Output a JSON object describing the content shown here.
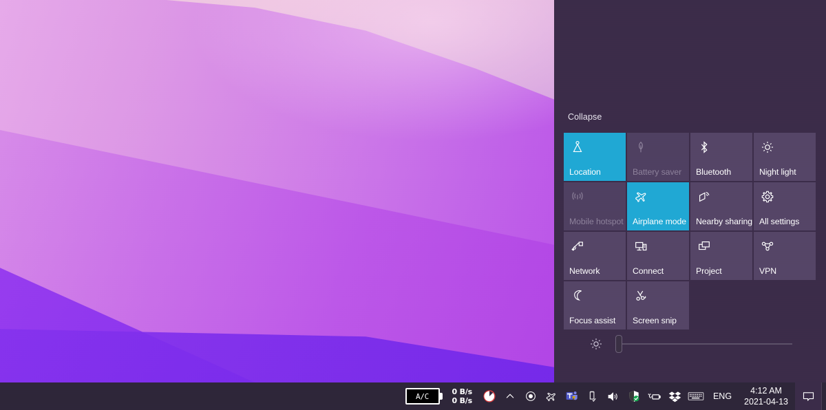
{
  "desktop": {
    "wallpaper_name": "purple-waves-wallpaper",
    "colors": {
      "light_pink": "#f2cfe4",
      "orchid": "#d08ae8",
      "violet": "#8d37ef",
      "deep_violet": "#6f26ea"
    }
  },
  "action_center": {
    "panel_name": "Action Center",
    "background_color": "#3b2c49",
    "accent_color": "#1fa8d4",
    "collapse_label": "Collapse",
    "quick_actions": [
      {
        "label": "Location",
        "icon": "location-icon",
        "state": "on"
      },
      {
        "label": "Battery saver",
        "icon": "leaf-icon",
        "state": "disabled"
      },
      {
        "label": "Bluetooth",
        "icon": "bluetooth-icon",
        "state": "off"
      },
      {
        "label": "Night light",
        "icon": "night-light-icon",
        "state": "off"
      },
      {
        "label": "Mobile hotspot",
        "icon": "hotspot-icon",
        "state": "disabled"
      },
      {
        "label": "Airplane mode",
        "icon": "airplane-icon",
        "state": "on"
      },
      {
        "label": "Nearby sharing",
        "icon": "nearby-sharing-icon",
        "state": "off"
      },
      {
        "label": "All settings",
        "icon": "gear-icon",
        "state": "off"
      },
      {
        "label": "Network",
        "icon": "network-icon",
        "state": "off"
      },
      {
        "label": "Connect",
        "icon": "connect-icon",
        "state": "off"
      },
      {
        "label": "Project",
        "icon": "project-icon",
        "state": "off"
      },
      {
        "label": "VPN",
        "icon": "vpn-icon",
        "state": "off"
      },
      {
        "label": "Focus assist",
        "icon": "moon-icon",
        "state": "off"
      },
      {
        "label": "Screen snip",
        "icon": "screen-snip-icon",
        "state": "off"
      }
    ],
    "brightness": {
      "icon": "brightness-icon",
      "value_percent": 0
    }
  },
  "taskbar": {
    "background_color": "#2e2539",
    "battery_widget": {
      "name": "ac-power-indicator",
      "text": "A/C"
    },
    "network_speed": {
      "upload": "0 B/s",
      "download": "0 B/s"
    },
    "tray_icons": [
      {
        "name": "disk-usage-icon"
      },
      {
        "name": "show-hidden-icons-chevron"
      },
      {
        "name": "record-icon"
      },
      {
        "name": "airplane-mode-tray-icon"
      },
      {
        "name": "microsoft-teams-icon"
      },
      {
        "name": "safely-remove-hardware-icon"
      },
      {
        "name": "volume-icon"
      },
      {
        "name": "windows-security-icon"
      },
      {
        "name": "battery-charging-icon"
      },
      {
        "name": "dropbox-icon"
      },
      {
        "name": "touch-keyboard-icon"
      }
    ],
    "language": "ENG",
    "clock": {
      "time": "4:12 AM",
      "date": "2021-04-13"
    },
    "notification_button": "notification-center-icon"
  }
}
